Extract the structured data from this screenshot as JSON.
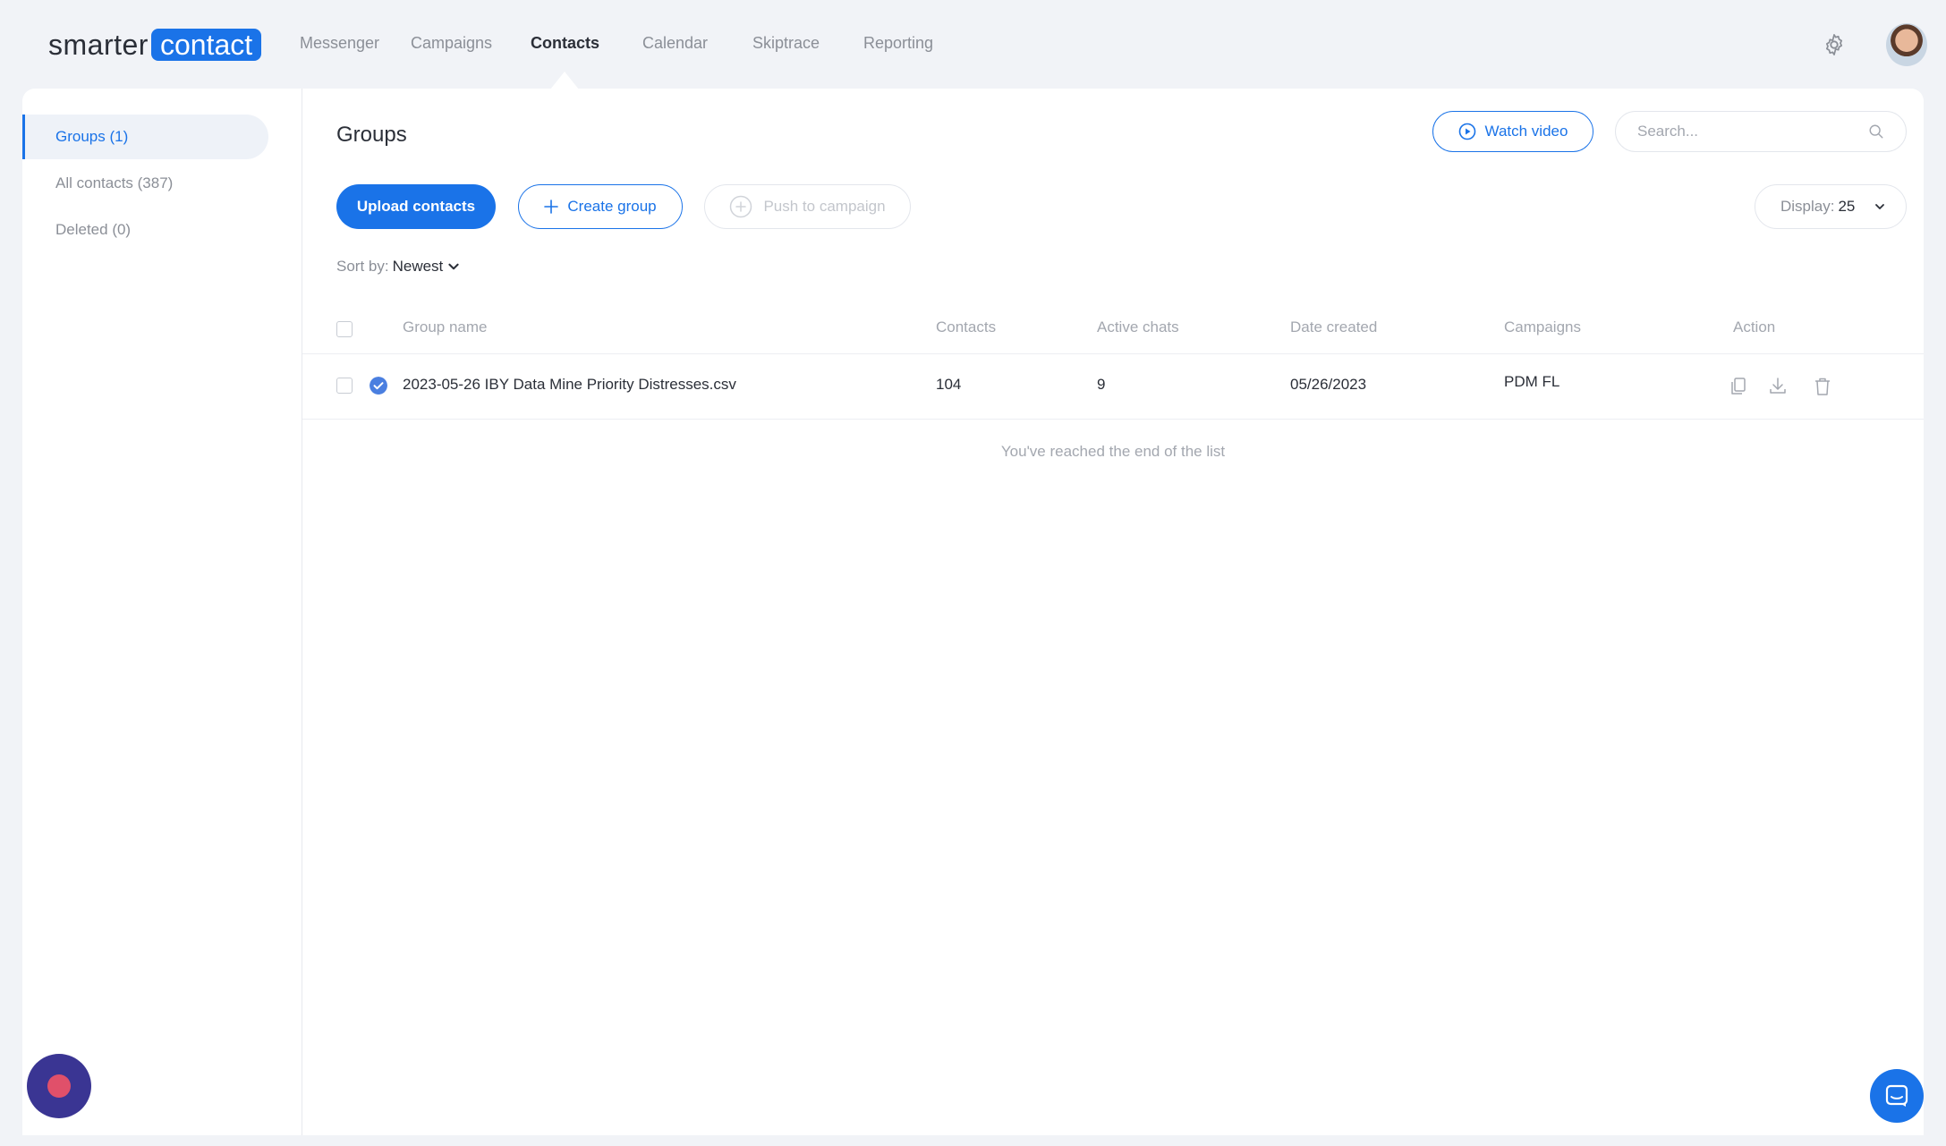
{
  "brand": {
    "logo_part1": "smarter",
    "logo_part2": "contact",
    "accent": "#1a73e8"
  },
  "nav": {
    "items": [
      {
        "label": "Messenger"
      },
      {
        "label": "Campaigns"
      },
      {
        "label": "Contacts",
        "active": true
      },
      {
        "label": "Calendar"
      },
      {
        "label": "Skiptrace"
      },
      {
        "label": "Reporting"
      }
    ]
  },
  "header_icons": {
    "settings": "gear-icon",
    "profile": "avatar"
  },
  "sidebar": {
    "items": [
      {
        "label": "Groups (1)",
        "active": true
      },
      {
        "label": "All contacts (387)"
      },
      {
        "label": "Deleted (0)"
      }
    ]
  },
  "main": {
    "title": "Groups",
    "watch_video_label": "Watch video",
    "search_placeholder": "Search...",
    "upload_label": "Upload contacts",
    "create_group_label": "Create group",
    "push_label": "Push to campaign",
    "display_label": "Display:",
    "display_value": "25",
    "sort_label": "Sort by:",
    "sort_value": "Newest"
  },
  "table": {
    "columns": [
      "Group name",
      "Contacts",
      "Active chats",
      "Date created",
      "Campaigns",
      "Action"
    ],
    "rows": [
      {
        "group_name": "2023-05-26 IBY Data Mine Priority Distresses.csv",
        "contacts": "104",
        "active_chats": "9",
        "date_created": "05/26/2023",
        "campaigns": "PDM FL",
        "actions": [
          "copy-icon",
          "download-icon",
          "trash-icon"
        ]
      }
    ],
    "end_message": "You've reached the end of the list"
  }
}
